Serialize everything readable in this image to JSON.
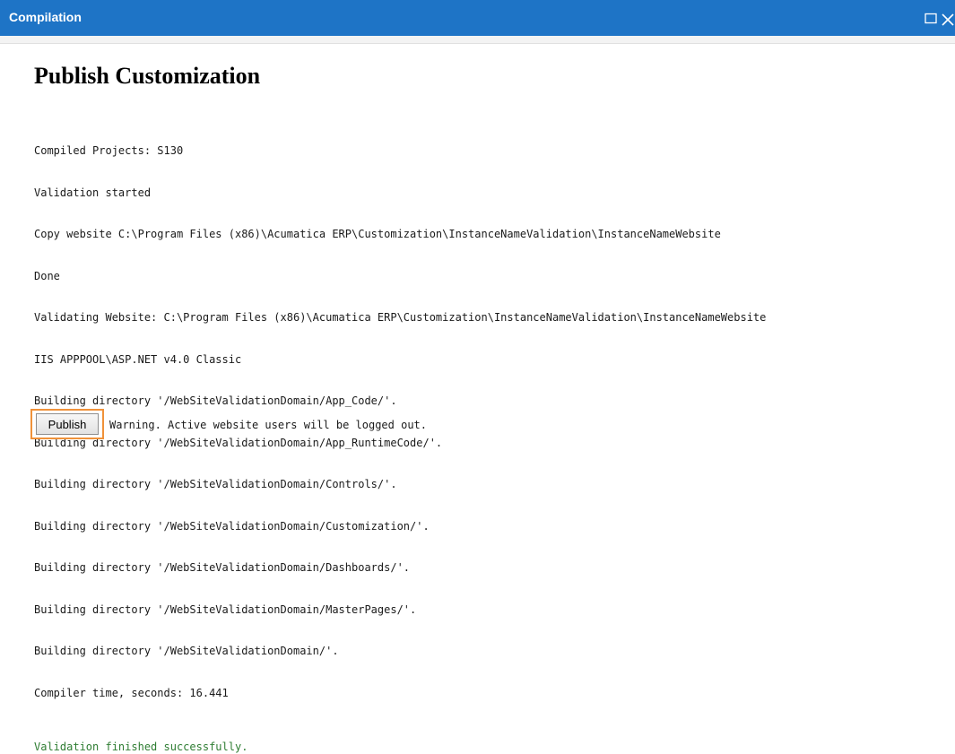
{
  "window": {
    "title": "Compilation",
    "accent_color": "#1e74c6"
  },
  "main": {
    "heading": "Publish Customization",
    "log_lines": [
      "Compiled Projects: S130",
      "Validation started",
      "Copy website C:\\Program Files (x86)\\Acumatica ERP\\Customization\\InstanceNameValidation\\InstanceNameWebsite",
      "Done",
      "Validating Website: C:\\Program Files (x86)\\Acumatica ERP\\Customization\\InstanceNameValidation\\InstanceNameWebsite",
      "IIS APPPOOL\\ASP.NET v4.0 Classic",
      "Building directory '/WebSiteValidationDomain/App_Code/'.",
      "Building directory '/WebSiteValidationDomain/App_RuntimeCode/'.",
      "Building directory '/WebSiteValidationDomain/Controls/'.",
      "Building directory '/WebSiteValidationDomain/Customization/'.",
      "Building directory '/WebSiteValidationDomain/Dashboards/'.",
      "Building directory '/WebSiteValidationDomain/MasterPages/'.",
      "Building directory '/WebSiteValidationDomain/'.",
      "Compiler time, seconds: 16.441"
    ],
    "success_message": "Validation finished successfully.",
    "success_color": "#2e7d32",
    "publish_label": "Publish",
    "warning": "Warning. Active website users will be logged out.",
    "highlight_color": "#f0923a"
  },
  "icons": {
    "maximize": "maximize-icon",
    "close": "close-icon"
  }
}
